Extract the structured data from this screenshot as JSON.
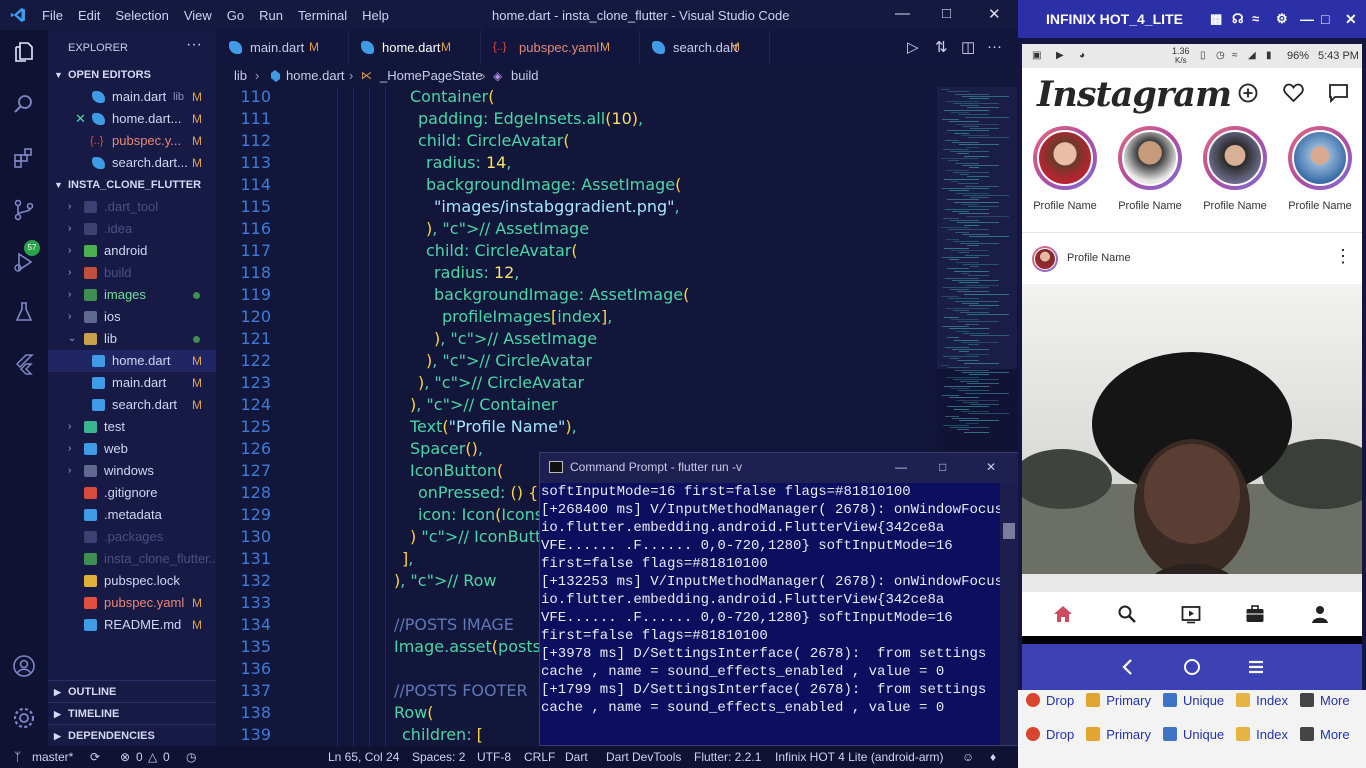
{
  "window": {
    "title": "home.dart - insta_clone_flutter - Visual Studio Code",
    "menu": [
      "File",
      "Edit",
      "Selection",
      "View",
      "Go",
      "Run",
      "Terminal",
      "Help"
    ]
  },
  "activity": {
    "scm_badge": "57"
  },
  "explorer": {
    "header": "EXPLORER",
    "open_editors_label": "OPEN EDITORS",
    "open_editors": [
      {
        "name": "main.dart",
        "path": "lib",
        "status": "M"
      },
      {
        "name": "home.dart...",
        "status": "M"
      },
      {
        "name": "pubspec.y...",
        "status": "M"
      },
      {
        "name": "search.dart...",
        "status": "M"
      }
    ],
    "project_label": "INSTA_CLONE_FLUTTER",
    "tree": [
      {
        "name": ".dart_tool",
        "status": ""
      },
      {
        "name": ".idea",
        "status": ""
      },
      {
        "name": "android",
        "status": ""
      },
      {
        "name": "build",
        "status": ""
      },
      {
        "name": "images",
        "status": ""
      },
      {
        "name": "ios",
        "status": ""
      },
      {
        "name": "lib",
        "status": ""
      },
      {
        "name": "home.dart",
        "status": "M"
      },
      {
        "name": "main.dart",
        "status": "M"
      },
      {
        "name": "search.dart",
        "status": "M"
      },
      {
        "name": "test",
        "status": ""
      },
      {
        "name": "web",
        "status": ""
      },
      {
        "name": "windows",
        "status": ""
      },
      {
        "name": ".gitignore",
        "status": ""
      },
      {
        "name": ".metadata",
        "status": ""
      },
      {
        "name": ".packages",
        "status": ""
      },
      {
        "name": "insta_clone_flutter...",
        "status": ""
      },
      {
        "name": "pubspec.lock",
        "status": ""
      },
      {
        "name": "pubspec.yaml",
        "status": "M"
      },
      {
        "name": "README.md",
        "status": "M"
      }
    ],
    "outline_label": "OUTLINE",
    "timeline_label": "TIMELINE",
    "dependencies_label": "DEPENDENCIES"
  },
  "tabs": [
    {
      "name": "main.dart",
      "status": "M"
    },
    {
      "name": "home.dart",
      "status": "M"
    },
    {
      "name": "pubspec.yaml",
      "status": "M"
    },
    {
      "name": "search.dart",
      "status": "M"
    }
  ],
  "breadcrumb": {
    "lib": "lib",
    "file": "home.dart",
    "cls": "_HomePageState",
    "method": "build"
  },
  "code_lines": [
    {
      "n": "110",
      "t": "Container("
    },
    {
      "n": "111",
      "t": "padding: EdgeInsets.all(10),"
    },
    {
      "n": "112",
      "t": "child: CircleAvatar("
    },
    {
      "n": "113",
      "t": "radius: 14,"
    },
    {
      "n": "114",
      "t": "backgroundImage: AssetImage("
    },
    {
      "n": "115",
      "t": "\"images/instabggradient.png\","
    },
    {
      "n": "116",
      "t": "), // AssetImage"
    },
    {
      "n": "117",
      "t": "child: CircleAvatar("
    },
    {
      "n": "118",
      "t": "radius: 12,"
    },
    {
      "n": "119",
      "t": "backgroundImage: AssetImage("
    },
    {
      "n": "120",
      "t": "profileImages[index],"
    },
    {
      "n": "121",
      "t": "), // AssetImage"
    },
    {
      "n": "122",
      "t": "), // CircleAvatar"
    },
    {
      "n": "123",
      "t": "), // CircleAvatar"
    },
    {
      "n": "124",
      "t": "), // Container"
    },
    {
      "n": "125",
      "t": "Text(\"Profile Name\"),"
    },
    {
      "n": "126",
      "t": "Spacer(),"
    },
    {
      "n": "127",
      "t": "IconButton("
    },
    {
      "n": "128",
      "t": "onPressed: () {},"
    },
    {
      "n": "129",
      "t": "icon: Icon(Icons"
    },
    {
      "n": "130",
      "t": ") // IconButton"
    },
    {
      "n": "131",
      "t": "],"
    },
    {
      "n": "132",
      "t": "), // Row"
    },
    {
      "n": "133",
      "t": ""
    },
    {
      "n": "134",
      "t": "//POSTS IMAGE"
    },
    {
      "n": "135",
      "t": "Image.asset(posts["
    },
    {
      "n": "136",
      "t": ""
    },
    {
      "n": "137",
      "t": "//POSTS FOOTER"
    },
    {
      "n": "138",
      "t": "Row("
    },
    {
      "n": "139",
      "t": "children: ["
    }
  ],
  "cmd": {
    "title": "Command Prompt - flutter  run -v",
    "lines": [
      "softInputMode=16 first=false flags=#81810100",
      "[+268400 ms] V/InputMethodManager( 2678): onWindowFocus:",
      "io.flutter.embedding.android.FlutterView{342ce8a",
      "VFE...... .F...... 0,0-720,1280} softInputMode=16",
      "first=false flags=#81810100",
      "[+132253 ms] V/InputMethodManager( 2678): onWindowFocus:",
      "io.flutter.embedding.android.FlutterView{342ce8a",
      "VFE...... .F...... 0,0-720,1280} softInputMode=16",
      "first=false flags=#81810100",
      "[+3978 ms] D/SettingsInterface( 2678):  from settings",
      "cache , name = sound_effects_enabled , value = 0",
      "[+1799 ms] D/SettingsInterface( 2678):  from settings",
      "cache , name = sound_effects_enabled , value = 0"
    ]
  },
  "status": {
    "branch": "master*",
    "errors": "0",
    "warnings": "0",
    "position": "Ln 65, Col 24",
    "spaces": "Spaces: 2",
    "encoding": "UTF-8",
    "eol": "CRLF",
    "language": "Dart",
    "devtools": "Dart DevTools",
    "flutter": "Flutter: 2.2.1",
    "device": "Infinix HOT 4 Lite (android-arm)"
  },
  "emulator": {
    "title": "INFINIX HOT_4_LITE",
    "status_bar": {
      "speed": "1.36",
      "speed_unit": "K/s",
      "battery": "96%",
      "time": "5:43 PM"
    },
    "app_logo": "Instagram",
    "stories": [
      "Profile Name",
      "Profile Name",
      "Profile Name",
      "Profile Name"
    ],
    "post_author": "Profile Name"
  },
  "below": {
    "rows": [
      [
        "Drop",
        "Primary",
        "Unique",
        "Index",
        "More"
      ],
      [
        "Drop",
        "Primary",
        "Unique",
        "Index",
        "More"
      ]
    ]
  }
}
